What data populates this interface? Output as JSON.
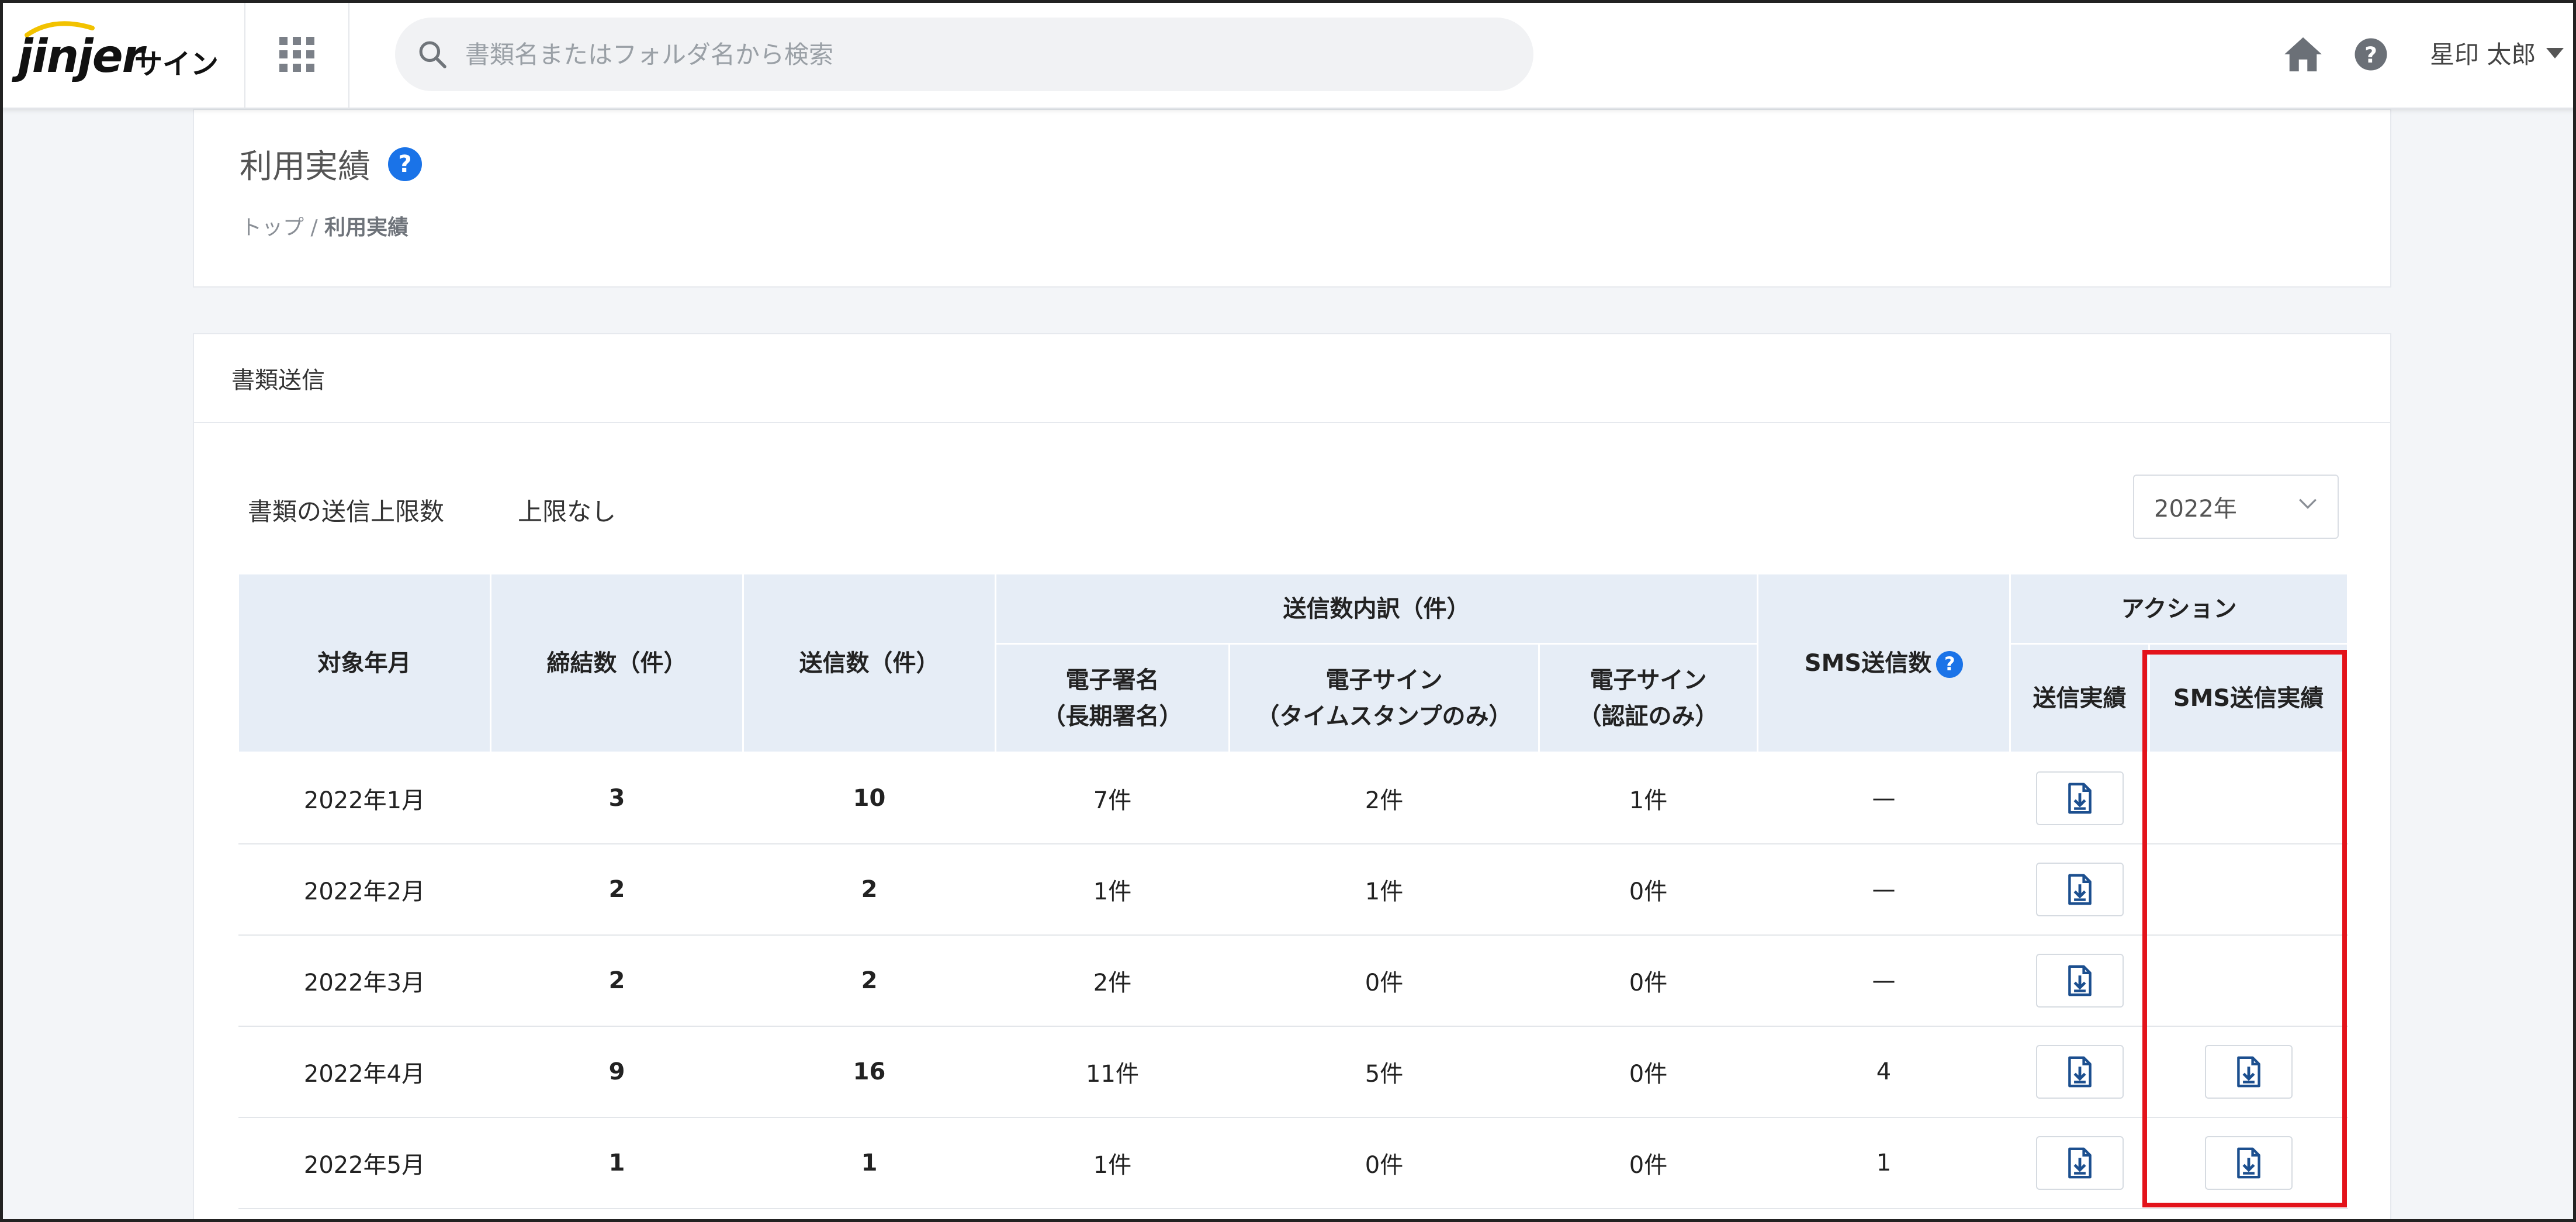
{
  "header": {
    "logo_text": "jinjer",
    "logo_suffix": "サイン",
    "search_placeholder": "書類名またはフォルダ名から検索",
    "icons": [
      "apps-grid-icon",
      "search-icon",
      "home-icon",
      "help-icon",
      "caret-down-icon"
    ],
    "user_name": "星印 太郎"
  },
  "page": {
    "title": "利用実績",
    "help_glyph": "?",
    "breadcrumb": {
      "home": "トップ",
      "separator": "/",
      "current": "利用実績"
    }
  },
  "section": {
    "title": "書類送信",
    "limit_label": "書類の送信上限数",
    "limit_value": "上限なし",
    "year_selected": "2022年"
  },
  "table": {
    "headers": {
      "month": "対象年月",
      "concluded": "締結数（件）",
      "sent": "送信数（件）",
      "breakdown": "送信数内訳（件）",
      "sig_long_1": "電子署名",
      "sig_long_2": "（長期署名）",
      "sign_ts_1": "電子サイン",
      "sign_ts_2": "（タイムスタンプのみ）",
      "sign_auth_1": "電子サイン",
      "sign_auth_2": "（認証のみ）",
      "sms_count": "SMS送信数",
      "action": "アクション",
      "send_record": "送信実績",
      "sms_record": "SMS送信実績"
    },
    "rows": [
      {
        "month": "2022年1月",
        "concluded": "3",
        "sent": "10",
        "sig_long": "7件",
        "sign_ts": "2件",
        "sign_auth": "1件",
        "sms": "—",
        "sms_download": false
      },
      {
        "month": "2022年2月",
        "concluded": "2",
        "sent": "2",
        "sig_long": "1件",
        "sign_ts": "1件",
        "sign_auth": "0件",
        "sms": "—",
        "sms_download": false
      },
      {
        "month": "2022年3月",
        "concluded": "2",
        "sent": "2",
        "sig_long": "2件",
        "sign_ts": "0件",
        "sign_auth": "0件",
        "sms": "—",
        "sms_download": false
      },
      {
        "month": "2022年4月",
        "concluded": "9",
        "sent": "16",
        "sig_long": "11件",
        "sign_ts": "5件",
        "sign_auth": "0件",
        "sms": "4",
        "sms_download": true
      },
      {
        "month": "2022年5月",
        "concluded": "1",
        "sent": "1",
        "sig_long": "1件",
        "sign_ts": "0件",
        "sign_auth": "0件",
        "sms": "1",
        "sms_download": true
      }
    ]
  },
  "colors": {
    "accent_blue": "#1a73e8",
    "header_cell_bg": "#e6edf6",
    "highlight_red": "#e3131b",
    "download_icon": "#1c4f8f"
  }
}
